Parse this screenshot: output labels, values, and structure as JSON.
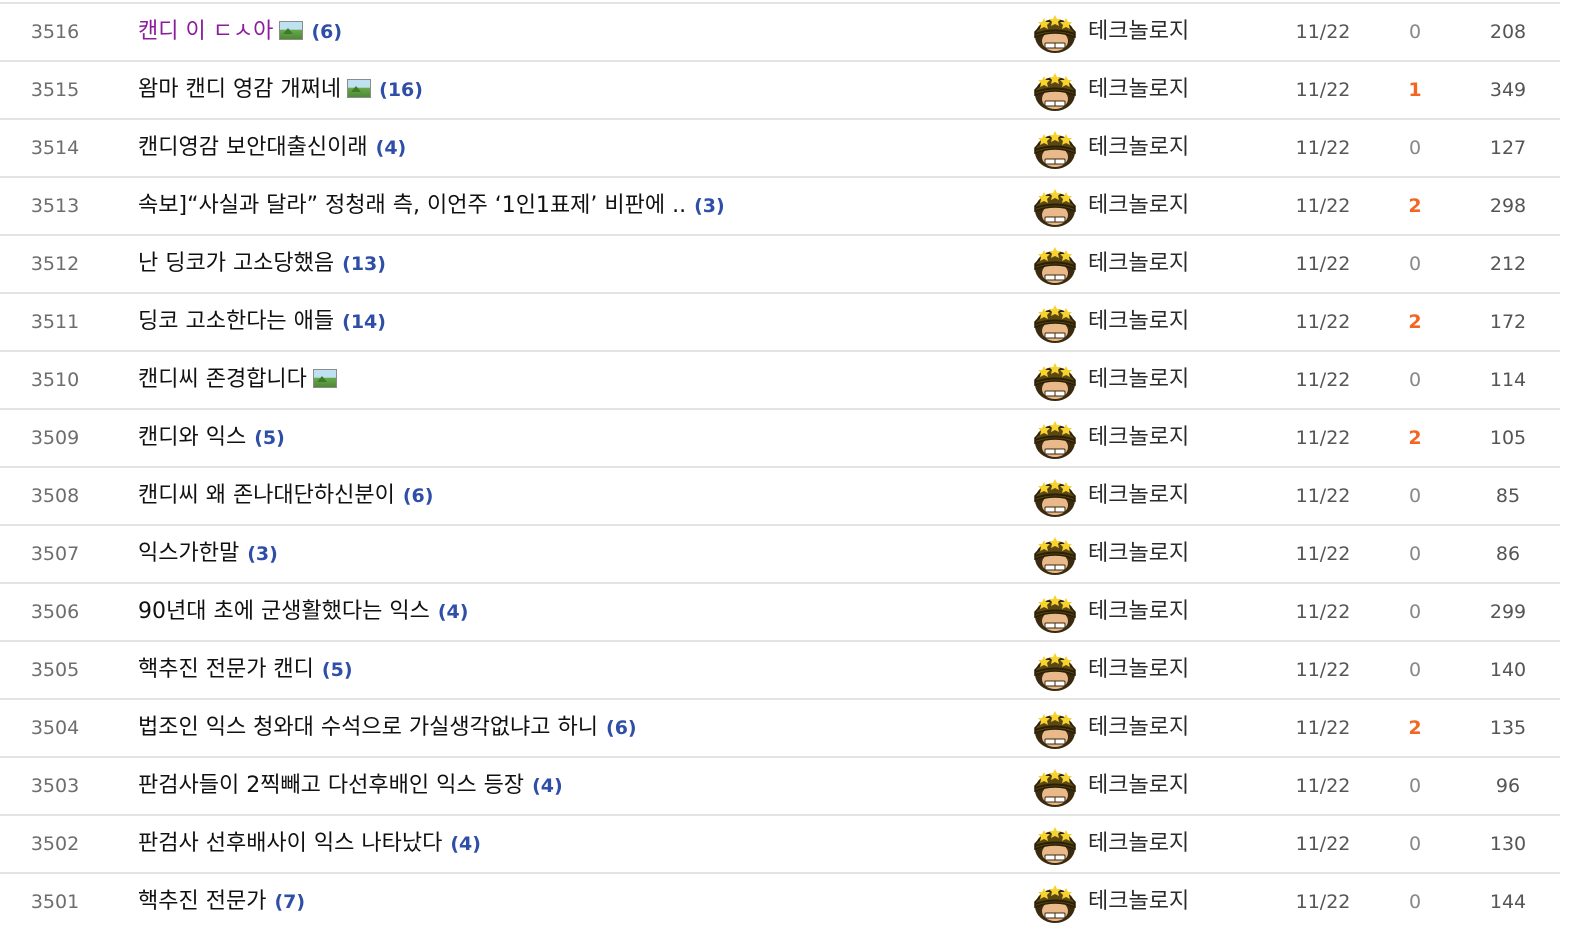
{
  "posts": [
    {
      "num": "3516",
      "title": "캔디 이 ㄷㅅ아",
      "has_image": true,
      "comments": "(6)",
      "author": "테크놀로지",
      "date": "11/22",
      "rec": "0",
      "views": "208",
      "visited": true
    },
    {
      "num": "3515",
      "title": "왐마 캔디 영감 개쩌네",
      "has_image": true,
      "comments": "(16)",
      "author": "테크놀로지",
      "date": "11/22",
      "rec": "1",
      "views": "349",
      "visited": false
    },
    {
      "num": "3514",
      "title": "캔디영감 보안대출신이래",
      "has_image": false,
      "comments": "(4)",
      "author": "테크놀로지",
      "date": "11/22",
      "rec": "0",
      "views": "127",
      "visited": false
    },
    {
      "num": "3513",
      "title": "속보]“사실과 달라” 정청래 측, 이언주 ‘1인1표제’ 비판에 ..",
      "has_image": false,
      "comments": "(3)",
      "author": "테크놀로지",
      "date": "11/22",
      "rec": "2",
      "views": "298",
      "visited": false
    },
    {
      "num": "3512",
      "title": "난 딩코가 고소당했음",
      "has_image": false,
      "comments": "(13)",
      "author": "테크놀로지",
      "date": "11/22",
      "rec": "0",
      "views": "212",
      "visited": false
    },
    {
      "num": "3511",
      "title": "딩코 고소한다는 애들",
      "has_image": false,
      "comments": "(14)",
      "author": "테크놀로지",
      "date": "11/22",
      "rec": "2",
      "views": "172",
      "visited": false
    },
    {
      "num": "3510",
      "title": "캔디씨 존경합니다",
      "has_image": true,
      "comments": "",
      "author": "테크놀로지",
      "date": "11/22",
      "rec": "0",
      "views": "114",
      "visited": false
    },
    {
      "num": "3509",
      "title": "캔디와 익스",
      "has_image": false,
      "comments": "(5)",
      "author": "테크놀로지",
      "date": "11/22",
      "rec": "2",
      "views": "105",
      "visited": false
    },
    {
      "num": "3508",
      "title": "캔디씨 왜 존나대단하신분이",
      "has_image": false,
      "comments": "(6)",
      "author": "테크놀로지",
      "date": "11/22",
      "rec": "0",
      "views": "85",
      "visited": false
    },
    {
      "num": "3507",
      "title": "익스가한말",
      "has_image": false,
      "comments": "(3)",
      "author": "테크놀로지",
      "date": "11/22",
      "rec": "0",
      "views": "86",
      "visited": false
    },
    {
      "num": "3506",
      "title": "90년대 초에 군생활했다는 익스",
      "has_image": false,
      "comments": "(4)",
      "author": "테크놀로지",
      "date": "11/22",
      "rec": "0",
      "views": "299",
      "visited": false
    },
    {
      "num": "3505",
      "title": "핵추진 전문가 캔디",
      "has_image": false,
      "comments": "(5)",
      "author": "테크놀로지",
      "date": "11/22",
      "rec": "0",
      "views": "140",
      "visited": false
    },
    {
      "num": "3504",
      "title": "법조인 익스 청와대 수석으로 가실생각없냐고 하니",
      "has_image": false,
      "comments": "(6)",
      "author": "테크놀로지",
      "date": "11/22",
      "rec": "2",
      "views": "135",
      "visited": false
    },
    {
      "num": "3503",
      "title": "판검사들이 2찍빼고 다선후배인 익스 등장",
      "has_image": false,
      "comments": "(4)",
      "author": "테크놀로지",
      "date": "11/22",
      "rec": "0",
      "views": "96",
      "visited": false
    },
    {
      "num": "3502",
      "title": "판검사 선후배사이 익스 나타났다",
      "has_image": false,
      "comments": "(4)",
      "author": "테크놀로지",
      "date": "11/22",
      "rec": "0",
      "views": "130",
      "visited": false
    },
    {
      "num": "3501",
      "title": "핵추진 전문가",
      "has_image": false,
      "comments": "(7)",
      "author": "테크놀로지",
      "date": "11/22",
      "rec": "0",
      "views": "144",
      "visited": false
    }
  ],
  "colors": {
    "visited_title": "#8b1c9c",
    "comment_count": "#2f4ea8",
    "recommend_hot": "#f26522",
    "row_border": "#e3e3e3"
  },
  "icons": {
    "image_attachment": "image-icon",
    "user_avatar": "soldier-helmet-avatar-icon"
  }
}
